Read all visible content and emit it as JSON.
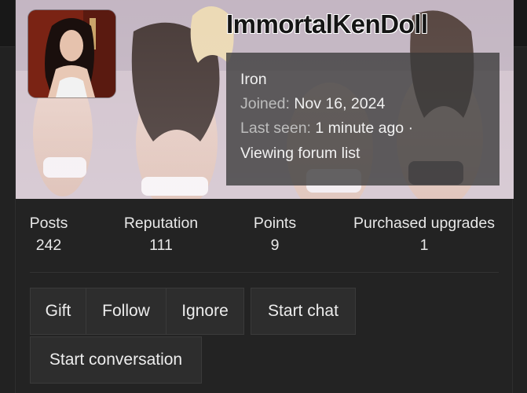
{
  "profile": {
    "username": "ImmortalKenDoll",
    "rank": "Iron",
    "joined_label": "Joined:",
    "joined_value": "Nov 16, 2024",
    "last_seen_label": "Last seen:",
    "last_seen_value": "1 minute ago ·",
    "activity": "Viewing forum list"
  },
  "stats": [
    {
      "label": "Posts",
      "value": "242"
    },
    {
      "label": "Reputation",
      "value": "111"
    },
    {
      "label": "Points",
      "value": "9"
    },
    {
      "label": "Purchased upgrades",
      "value": "1"
    }
  ],
  "actions": {
    "gift": "Gift",
    "follow": "Follow",
    "ignore": "Ignore",
    "start_chat": "Start chat",
    "start_conversation": "Start conversation"
  },
  "colors": {
    "background": "#222222",
    "info_box": "#3a3a3a",
    "button": "#2d2d2d"
  }
}
